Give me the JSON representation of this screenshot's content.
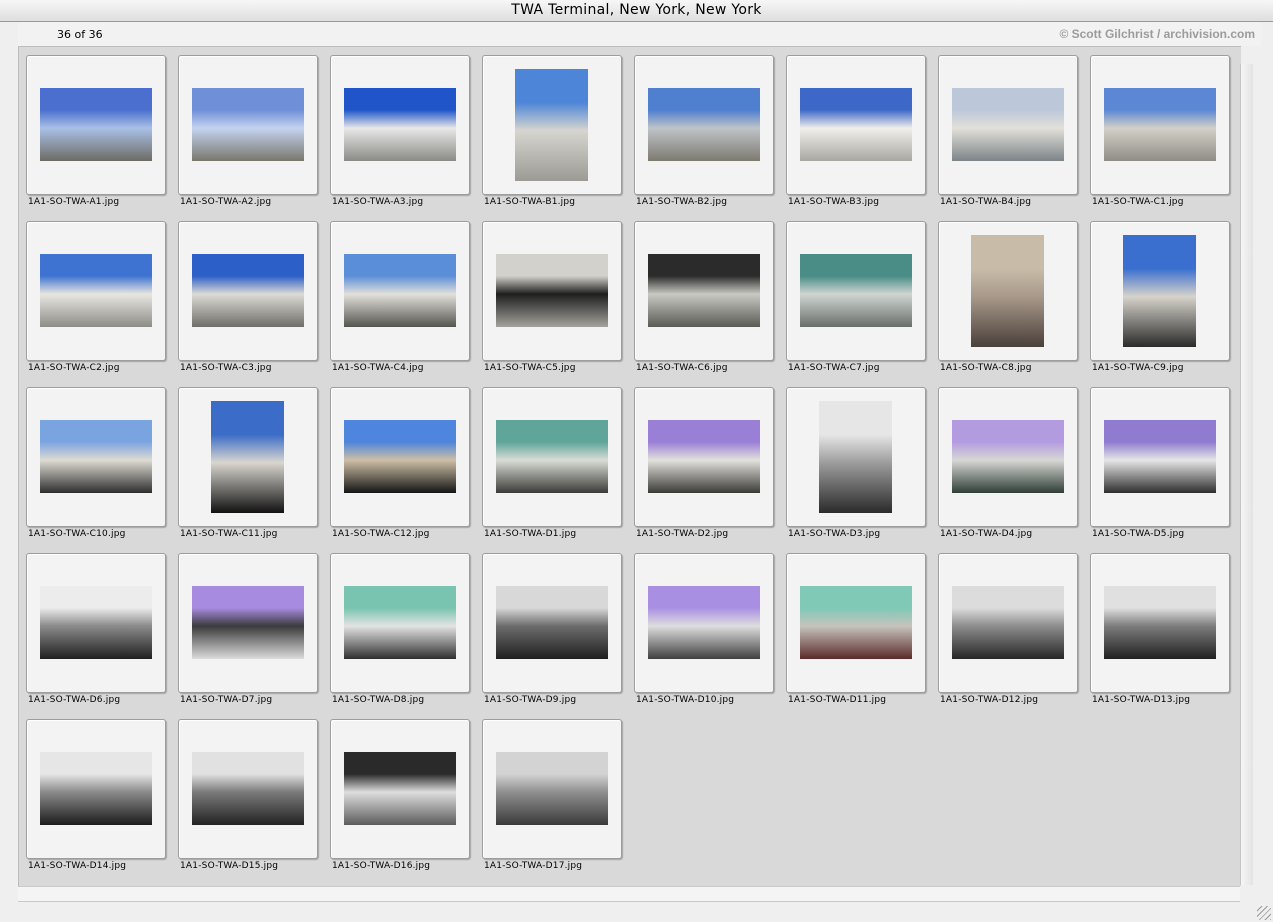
{
  "window": {
    "title": "TWA Terminal, New York, New York"
  },
  "infobar": {
    "count": "36 of 36",
    "credit": "© Scott Gilchrist / archivision.com"
  },
  "thumbnails": [
    {
      "name": "1A1-SO-TWA-A1.jpg",
      "orient": "land",
      "colors": [
        "#4a6fcf",
        "#a9c0e6",
        "#6d6b63"
      ]
    },
    {
      "name": "1A1-SO-TWA-A2.jpg",
      "orient": "land",
      "colors": [
        "#6f8fd8",
        "#c3d3ef",
        "#7a766c"
      ]
    },
    {
      "name": "1A1-SO-TWA-A3.jpg",
      "orient": "land",
      "colors": [
        "#1f55c9",
        "#e8e8e8",
        "#8a8a86"
      ]
    },
    {
      "name": "1A1-SO-TWA-B1.jpg",
      "orient": "port",
      "colors": [
        "#4d86d8",
        "#d7d5cf",
        "#9b9a94"
      ]
    },
    {
      "name": "1A1-SO-TWA-B2.jpg",
      "orient": "land",
      "colors": [
        "#4f7fcf",
        "#bfc4c8",
        "#7d7a70"
      ]
    },
    {
      "name": "1A1-SO-TWA-B3.jpg",
      "orient": "land",
      "colors": [
        "#3e68c8",
        "#f0efea",
        "#a8a7a0"
      ]
    },
    {
      "name": "1A1-SO-TWA-B4.jpg",
      "orient": "land",
      "colors": [
        "#bcc7d9",
        "#e2e0d9",
        "#7c8488"
      ]
    },
    {
      "name": "1A1-SO-TWA-C1.jpg",
      "orient": "land",
      "colors": [
        "#5c87d4",
        "#d2d0c8",
        "#8f8d84"
      ]
    },
    {
      "name": "1A1-SO-TWA-C2.jpg",
      "orient": "land",
      "colors": [
        "#3f73d1",
        "#e8e6e0",
        "#8d8c86"
      ]
    },
    {
      "name": "1A1-SO-TWA-C3.jpg",
      "orient": "land",
      "colors": [
        "#2c5fc8",
        "#dcdbd5",
        "#6f6d68"
      ]
    },
    {
      "name": "1A1-SO-TWA-C4.jpg",
      "orient": "land",
      "colors": [
        "#5b8ed8",
        "#e2e0da",
        "#55554f"
      ]
    },
    {
      "name": "1A1-SO-TWA-C5.jpg",
      "orient": "land",
      "colors": [
        "#d3d1cc",
        "#1e1e1e",
        "#a4a39d"
      ]
    },
    {
      "name": "1A1-SO-TWA-C6.jpg",
      "orient": "land",
      "colors": [
        "#2b2b2b",
        "#c9c9c3",
        "#5a5a55"
      ]
    },
    {
      "name": "1A1-SO-TWA-C7.jpg",
      "orient": "land",
      "colors": [
        "#4a8c86",
        "#cfd6d2",
        "#6a6e6b"
      ]
    },
    {
      "name": "1A1-SO-TWA-C8.jpg",
      "orient": "port",
      "colors": [
        "#c8bca9",
        "#a8998a",
        "#4a3f3a"
      ]
    },
    {
      "name": "1A1-SO-TWA-C9.jpg",
      "orient": "port",
      "colors": [
        "#3a6fd0",
        "#d6d3cb",
        "#2a2a2a"
      ]
    },
    {
      "name": "1A1-SO-TWA-C10.jpg",
      "orient": "land",
      "colors": [
        "#7aa4e0",
        "#dedbd3",
        "#2e2e2e"
      ]
    },
    {
      "name": "1A1-SO-TWA-C11.jpg",
      "orient": "port",
      "colors": [
        "#3b6cc8",
        "#d9d6cf",
        "#111111"
      ]
    },
    {
      "name": "1A1-SO-TWA-C12.jpg",
      "orient": "land",
      "colors": [
        "#4d86dc",
        "#cdbfa6",
        "#151515"
      ]
    },
    {
      "name": "1A1-SO-TWA-D1.jpg",
      "orient": "land",
      "colors": [
        "#5fa59a",
        "#dadcd6",
        "#3b3b38"
      ]
    },
    {
      "name": "1A1-SO-TWA-D2.jpg",
      "orient": "land",
      "colors": [
        "#9a7fd6",
        "#e3e1dc",
        "#3a3a36"
      ]
    },
    {
      "name": "1A1-SO-TWA-D3.jpg",
      "orient": "port",
      "colors": [
        "#e6e6e6",
        "#9d9d9d",
        "#2a2a2a"
      ]
    },
    {
      "name": "1A1-SO-TWA-D4.jpg",
      "orient": "land",
      "colors": [
        "#b39be0",
        "#d8d8d4",
        "#2f3e37"
      ]
    },
    {
      "name": "1A1-SO-TWA-D5.jpg",
      "orient": "land",
      "colors": [
        "#8f7bd0",
        "#e6e6e6",
        "#2e2e2e"
      ]
    },
    {
      "name": "1A1-SO-TWA-D6.jpg",
      "orient": "land",
      "colors": [
        "#ececec",
        "#8a8a8a",
        "#1f1f1f"
      ]
    },
    {
      "name": "1A1-SO-TWA-D7.jpg",
      "orient": "land",
      "colors": [
        "#a78be0",
        "#3b3b3b",
        "#dcdcdc"
      ]
    },
    {
      "name": "1A1-SO-TWA-D8.jpg",
      "orient": "land",
      "colors": [
        "#79c4b0",
        "#e3e3e3",
        "#2f2f2f"
      ]
    },
    {
      "name": "1A1-SO-TWA-D9.jpg",
      "orient": "land",
      "colors": [
        "#d8d8d8",
        "#6c6c6c",
        "#1f1f1f"
      ]
    },
    {
      "name": "1A1-SO-TWA-D10.jpg",
      "orient": "land",
      "colors": [
        "#a98fe2",
        "#dedede",
        "#404040"
      ]
    },
    {
      "name": "1A1-SO-TWA-D11.jpg",
      "orient": "land",
      "colors": [
        "#7fc9b6",
        "#c6c3bd",
        "#5b2b2b"
      ]
    },
    {
      "name": "1A1-SO-TWA-D12.jpg",
      "orient": "land",
      "colors": [
        "#dcdcdc",
        "#8d8d8d",
        "#262626"
      ]
    },
    {
      "name": "1A1-SO-TWA-D13.jpg",
      "orient": "land",
      "colors": [
        "#e0e0e0",
        "#7c7c7c",
        "#202020"
      ]
    },
    {
      "name": "1A1-SO-TWA-D14.jpg",
      "orient": "land",
      "colors": [
        "#e6e6e6",
        "#8a8a8a",
        "#1c1c1c"
      ]
    },
    {
      "name": "1A1-SO-TWA-D15.jpg",
      "orient": "land",
      "colors": [
        "#e1e1e1",
        "#7a7a7a",
        "#222222"
      ]
    },
    {
      "name": "1A1-SO-TWA-D16.jpg",
      "orient": "land",
      "colors": [
        "#2a2a2a",
        "#dedede",
        "#5c5c5c"
      ]
    },
    {
      "name": "1A1-SO-TWA-D17.jpg",
      "orient": "land",
      "colors": [
        "#d3d3d3",
        "#8f8f8f",
        "#3a3a3a"
      ]
    }
  ]
}
